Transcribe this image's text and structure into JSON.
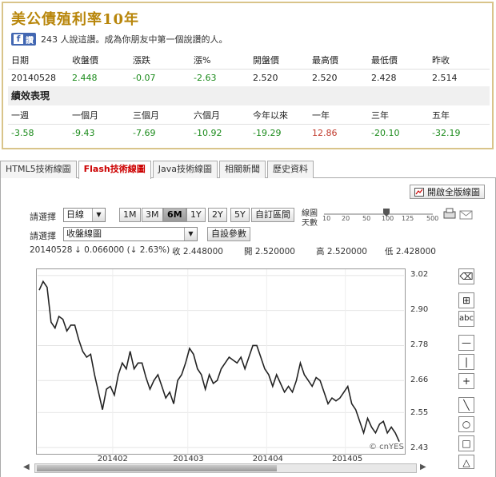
{
  "title": "美公債殖利率10年",
  "facebook": {
    "button_label": "讚",
    "text": "243 人說這讚。成為你朋友中第一個說讚的人。"
  },
  "quote": {
    "headers": [
      "日期",
      "收盤價",
      "漲跌",
      "漲%",
      "開盤價",
      "最高價",
      "最低價",
      "昨收"
    ],
    "values": [
      "20140528",
      "2.448",
      "-0.07",
      "-2.63",
      "2.520",
      "2.520",
      "2.428",
      "2.514"
    ]
  },
  "performance": {
    "label": "績效表現",
    "headers": [
      "一週",
      "一個月",
      "三個月",
      "六個月",
      "今年以來",
      "一年",
      "三年",
      "五年"
    ],
    "values": [
      "-3.58",
      "-9.43",
      "-7.69",
      "-10.92",
      "-19.29",
      "12.86",
      "-20.10",
      "-32.19"
    ]
  },
  "tabs": [
    "HTML5技術線圖",
    "Flash技術線圖",
    "Java技術線圖",
    "相關新聞",
    "歷史資料"
  ],
  "active_tab": 1,
  "toolbar": {
    "full_chart_label": "開啟全版線圖",
    "select_label_1": "請選擇",
    "period_select": "日線",
    "ranges": [
      "1M",
      "3M",
      "6M",
      "1Y",
      "2Y",
      "5Y"
    ],
    "active_range": "6M",
    "custom_range_label": "自訂區間",
    "line_days_label_1": "線圖",
    "line_days_label_2": "天數",
    "line_days_ticks": [
      "10",
      "20",
      "50",
      "100",
      "125",
      "500"
    ],
    "select_label_2": "請選擇",
    "chart_type_select": "收盤線圖",
    "settings_label": "自設參數"
  },
  "info": {
    "date": "20140528",
    "change": "↓ 0.066000 (↓ 2.63%)",
    "close": "收 2.448000",
    "open": "開 2.520000",
    "high": "高 2.520000",
    "low": "低 2.428000"
  },
  "watermark": "© cnYES",
  "chart_data": {
    "type": "line",
    "x_labels": [
      "201402",
      "201403",
      "201404",
      "201405"
    ],
    "y_ticks": [
      "3.02",
      "2.90",
      "2.78",
      "2.66",
      "2.55",
      "2.43"
    ],
    "ylim": [
      2.43,
      3.02
    ],
    "values": [
      2.97,
      3.0,
      2.98,
      2.86,
      2.84,
      2.88,
      2.87,
      2.83,
      2.85,
      2.85,
      2.8,
      2.76,
      2.74,
      2.75,
      2.68,
      2.62,
      2.56,
      2.63,
      2.64,
      2.61,
      2.68,
      2.72,
      2.7,
      2.76,
      2.7,
      2.72,
      2.72,
      2.67,
      2.63,
      2.66,
      2.68,
      2.64,
      2.6,
      2.62,
      2.58,
      2.66,
      2.68,
      2.72,
      2.77,
      2.75,
      2.7,
      2.68,
      2.63,
      2.68,
      2.65,
      2.66,
      2.7,
      2.72,
      2.74,
      2.73,
      2.72,
      2.74,
      2.7,
      2.74,
      2.78,
      2.78,
      2.74,
      2.7,
      2.68,
      2.64,
      2.68,
      2.65,
      2.62,
      2.64,
      2.62,
      2.66,
      2.72,
      2.68,
      2.66,
      2.64,
      2.67,
      2.66,
      2.62,
      2.58,
      2.6,
      2.59,
      2.6,
      2.62,
      2.64,
      2.58,
      2.56,
      2.52,
      2.48,
      2.53,
      2.5,
      2.48,
      2.51,
      2.52,
      2.48,
      2.5,
      2.48,
      2.45
    ]
  },
  "tools": [
    "eraser-icon",
    "zoom-in-icon",
    "text-icon",
    "hline-icon",
    "vline-icon",
    "cross-icon",
    "diagonal-line-icon",
    "ellipse-icon",
    "rectangle-icon",
    "triangle-icon"
  ]
}
